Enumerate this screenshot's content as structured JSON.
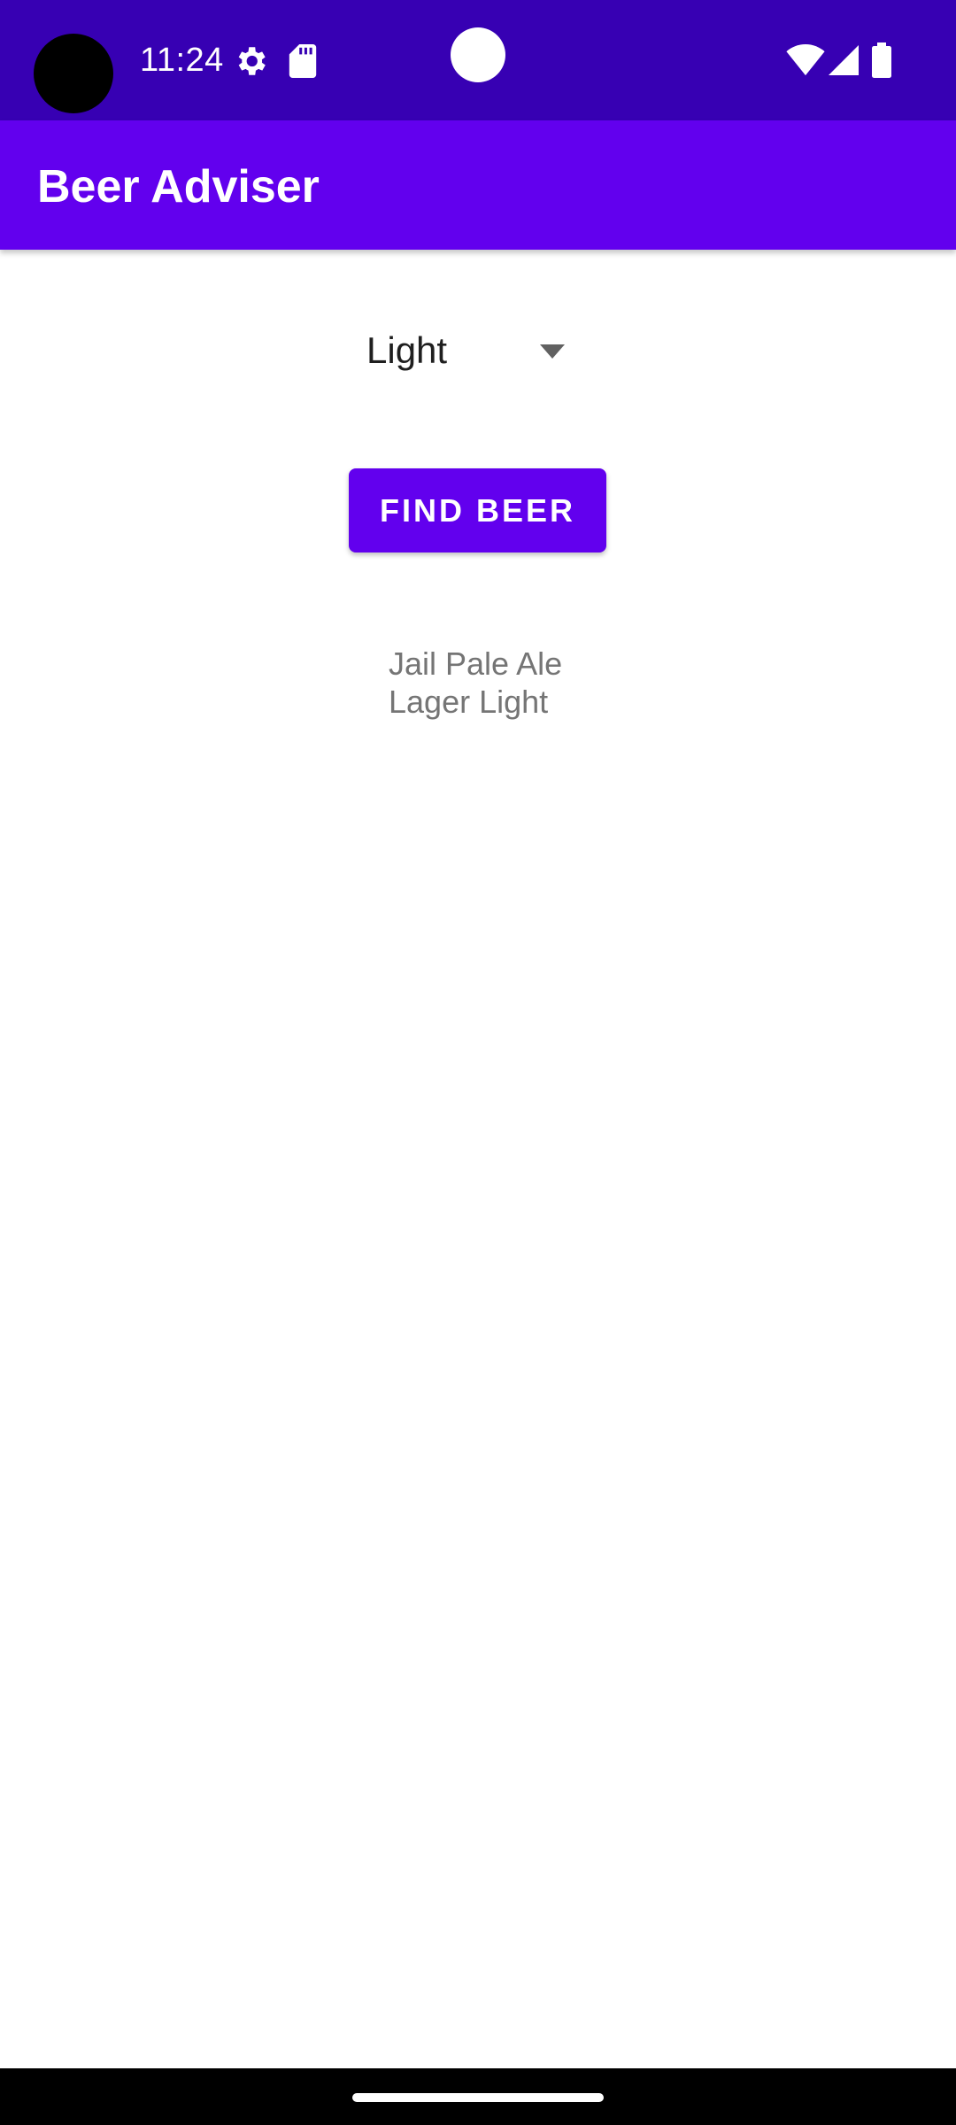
{
  "status_bar": {
    "time": "11:24",
    "background": "#3700b3",
    "icons": [
      "settings-icon",
      "sdcard-icon",
      "wifi-icon",
      "signal-icon",
      "battery-icon"
    ]
  },
  "app_bar": {
    "title": "Beer Adviser",
    "background": "#6200ee"
  },
  "spinner": {
    "selected_value": "Light",
    "icon": "dropdown-arrow-icon"
  },
  "find_button": {
    "label": "FIND BEER",
    "background": "#6200ee"
  },
  "results": {
    "items": [
      "Jail Pale Ale",
      "Lager Light"
    ],
    "text_color": "#757575"
  },
  "nav_bar": {
    "icon": "home-handle"
  }
}
